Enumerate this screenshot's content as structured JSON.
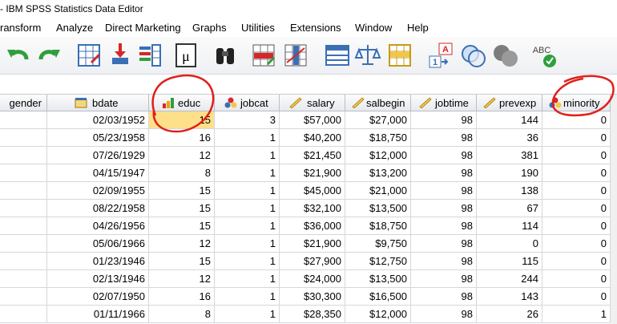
{
  "window": {
    "title": "- IBM SPSS Statistics Data Editor"
  },
  "menu": [
    "ransform",
    "Analyze",
    "Direct Marketing",
    "Graphs",
    "Utilities",
    "Extensions",
    "Window",
    "Help"
  ],
  "toolbar": {
    "icons": [
      "undo-icon",
      "redo-icon",
      "goto-case-icon",
      "goto-variable-icon",
      "variables-icon",
      "descriptives-icon",
      "find-icon",
      "insert-cases-icon",
      "insert-variable-icon",
      "split-file-icon",
      "weight-cases-icon",
      "select-cases-icon",
      "value-labels-icon",
      "use-sets-icon",
      "show-all-variables-icon",
      "spell-check-icon"
    ]
  },
  "columns": [
    {
      "name": "gender",
      "icon": "nominal-icon"
    },
    {
      "name": "bdate",
      "icon": "date-icon"
    },
    {
      "name": "educ",
      "icon": "ordinal-icon"
    },
    {
      "name": "jobcat",
      "icon": "nominal-icon"
    },
    {
      "name": "salary",
      "icon": "scale-icon"
    },
    {
      "name": "salbegin",
      "icon": "scale-icon"
    },
    {
      "name": "jobtime",
      "icon": "scale-icon"
    },
    {
      "name": "prevexp",
      "icon": "scale-icon"
    },
    {
      "name": "minority",
      "icon": "nominal-icon"
    }
  ],
  "rows": [
    [
      "",
      "02/03/1952",
      "15",
      "3",
      "$57,000",
      "$27,000",
      "98",
      "144",
      "0"
    ],
    [
      "",
      "05/23/1958",
      "16",
      "1",
      "$40,200",
      "$18,750",
      "98",
      "36",
      "0"
    ],
    [
      "",
      "07/26/1929",
      "12",
      "1",
      "$21,450",
      "$12,000",
      "98",
      "381",
      "0"
    ],
    [
      "",
      "04/15/1947",
      "8",
      "1",
      "$21,900",
      "$13,200",
      "98",
      "190",
      "0"
    ],
    [
      "",
      "02/09/1955",
      "15",
      "1",
      "$45,000",
      "$21,000",
      "98",
      "138",
      "0"
    ],
    [
      "",
      "08/22/1958",
      "15",
      "1",
      "$32,100",
      "$13,500",
      "98",
      "67",
      "0"
    ],
    [
      "",
      "04/26/1956",
      "15",
      "1",
      "$36,000",
      "$18,750",
      "98",
      "114",
      "0"
    ],
    [
      "",
      "05/06/1966",
      "12",
      "1",
      "$21,900",
      "$9,750",
      "98",
      "0",
      "0"
    ],
    [
      "",
      "01/23/1946",
      "15",
      "1",
      "$27,900",
      "$12,750",
      "98",
      "115",
      "0"
    ],
    [
      "",
      "02/13/1946",
      "12",
      "1",
      "$24,000",
      "$13,500",
      "98",
      "244",
      "0"
    ],
    [
      "",
      "02/07/1950",
      "16",
      "1",
      "$30,300",
      "$16,500",
      "98",
      "143",
      "0"
    ],
    [
      "",
      "01/11/1966",
      "8",
      "1",
      "$28,350",
      "$12,000",
      "98",
      "26",
      "1"
    ]
  ],
  "selected_cell": {
    "row": 0,
    "column": "educ"
  },
  "colors": {
    "selection": "#ffe08a",
    "annotation": "#e0201b"
  }
}
